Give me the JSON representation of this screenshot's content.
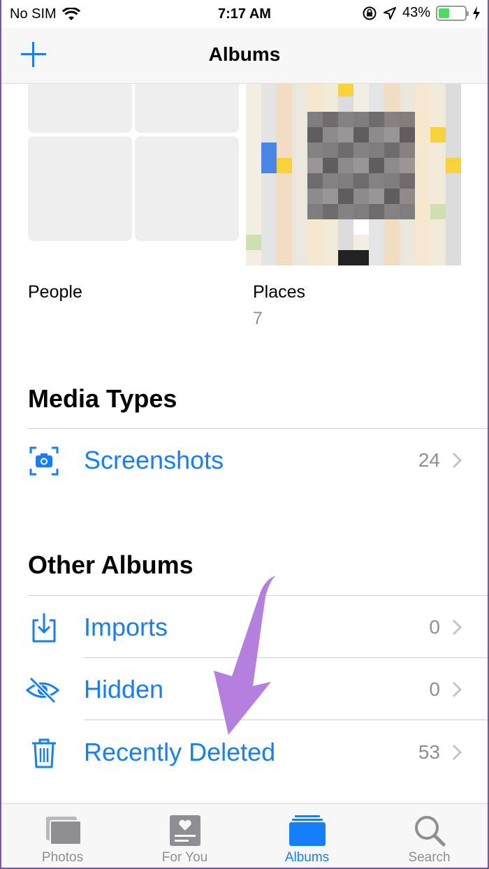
{
  "status_bar": {
    "carrier": "No SIM",
    "time": "7:17 AM",
    "battery_percent": "43%",
    "battery_level": 0.43
  },
  "nav": {
    "title": "Albums",
    "add_icon": "plus-icon"
  },
  "top_albums": [
    {
      "label": "People",
      "count": ""
    },
    {
      "label": "Places",
      "count": "7"
    }
  ],
  "media_types": {
    "title": "Media Types",
    "items": [
      {
        "label": "Screenshots",
        "count": "24",
        "icon": "screenshot-icon"
      }
    ]
  },
  "other_albums": {
    "title": "Other Albums",
    "items": [
      {
        "label": "Imports",
        "count": "0",
        "icon": "import-icon"
      },
      {
        "label": "Hidden",
        "count": "0",
        "icon": "hidden-eye-icon"
      },
      {
        "label": "Recently Deleted",
        "count": "53",
        "icon": "trash-icon"
      }
    ]
  },
  "tabs": [
    {
      "label": "Photos",
      "icon": "photos-icon",
      "active": false
    },
    {
      "label": "For You",
      "icon": "for-you-icon",
      "active": false
    },
    {
      "label": "Albums",
      "icon": "albums-icon",
      "active": true
    },
    {
      "label": "Search",
      "icon": "search-icon",
      "active": false
    }
  ],
  "colors": {
    "accent": "#147efb",
    "annotation_arrow": "#b57fe0",
    "battery": "#4cd964"
  }
}
